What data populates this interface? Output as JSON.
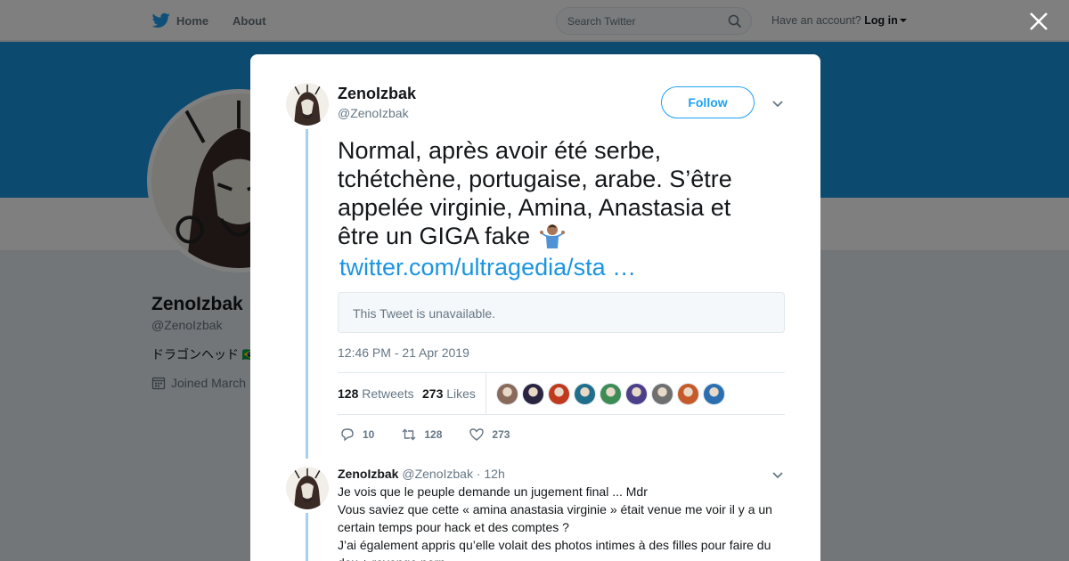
{
  "topbar": {
    "home_label": "Home",
    "about_label": "About",
    "search_placeholder": "Search Twitter",
    "account_prompt": "Have an account?",
    "login_label": "Log in"
  },
  "profile": {
    "name": "ZenoIzbak",
    "handle": "@ZenoIzbak",
    "bio": "ドラゴンヘッド 🇧🇷",
    "joined": "Joined March"
  },
  "tweet": {
    "author_name": "ZenoIzbak",
    "author_handle": "@ZenoIzbak",
    "follow_label": "Follow",
    "text": "Normal, après avoir été serbe, tchétchène, portugaise, arabe. S’être appelée virginie, Amina, Anastasia et être un GIGA fake",
    "link": "twitter.com/ultragedia/sta …",
    "quoted_unavailable": "This Tweet is unavailable.",
    "timestamp": "12:46 PM - 21 Apr 2019",
    "retweets_count": "128",
    "retweets_label": "Retweets",
    "likes_count": "273",
    "likes_label": "Likes",
    "liker_colors": [
      "#8a6a5a",
      "#2a2440",
      "#c23a1e",
      "#1f6e8c",
      "#3d8c55",
      "#4b3f8a",
      "#6f6f6f",
      "#c65a2a",
      "#2b6fb0"
    ],
    "actions": {
      "replies": "10",
      "retweets": "128",
      "likes": "273"
    }
  },
  "reply": {
    "author_name": "ZenoIzbak",
    "author_handle": "@ZenoIzbak",
    "time": "· 12h",
    "lines": [
      "Je vois que le peuple demande un jugement final ... Mdr",
      "Vous saviez que cette « amina anastasia virginie » était venue me voir il y a un",
      "certain temps pour hack et des comptes ?",
      "J’ai également appris qu’elle volait des photos intimes à des filles pour faire du",
      "dox + revenge porn"
    ]
  },
  "colors": {
    "accent": "#1da1f2",
    "banner": "#1b95e0",
    "thread_line": "#a3d2f1"
  }
}
